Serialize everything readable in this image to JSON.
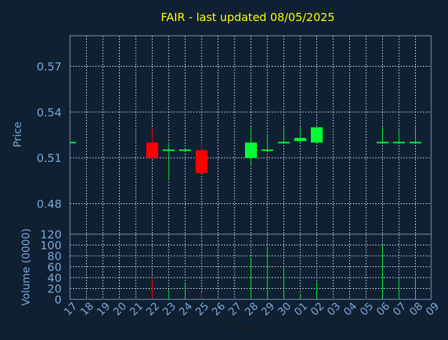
{
  "chart_data": {
    "title": "FAIR - last updated 08/05/2025",
    "type": "candlestick",
    "price_panel": {
      "ylabel": "Price",
      "ylim": [
        0.46,
        0.59
      ],
      "yticks": [
        "0.57",
        "0.54",
        "0.51",
        "0.48"
      ],
      "ytick_values": [
        0.57,
        0.54,
        0.51,
        0.48
      ],
      "candles": [
        {
          "day": "17",
          "open": 0.52,
          "high": 0.52,
          "low": 0.52,
          "close": 0.52
        },
        {
          "day": "22",
          "open": 0.52,
          "high": 0.53,
          "low": 0.51,
          "close": 0.51
        },
        {
          "day": "23",
          "open": 0.515,
          "high": 0.52,
          "low": 0.495,
          "close": 0.515
        },
        {
          "day": "24",
          "open": 0.515,
          "high": 0.515,
          "low": 0.515,
          "close": 0.515
        },
        {
          "day": "25",
          "open": 0.515,
          "high": 0.52,
          "low": 0.5,
          "close": 0.5
        },
        {
          "day": "28",
          "open": 0.51,
          "high": 0.53,
          "low": 0.505,
          "close": 0.52
        },
        {
          "day": "29",
          "open": 0.515,
          "high": 0.525,
          "low": 0.515,
          "close": 0.515
        },
        {
          "day": "30",
          "open": 0.52,
          "high": 0.53,
          "low": 0.52,
          "close": 0.52
        },
        {
          "day": "01",
          "open": 0.521,
          "high": 0.53,
          "low": 0.52,
          "close": 0.523
        },
        {
          "day": "02",
          "open": 0.52,
          "high": 0.53,
          "low": 0.52,
          "close": 0.53
        },
        {
          "day": "06",
          "open": 0.52,
          "high": 0.53,
          "low": 0.52,
          "close": 0.52
        },
        {
          "day": "07",
          "open": 0.52,
          "high": 0.528,
          "low": 0.52,
          "close": 0.52
        },
        {
          "day": "08",
          "open": 0.52,
          "high": 0.53,
          "low": 0.52,
          "close": 0.52
        }
      ]
    },
    "volume_panel": {
      "ylabel": "Volume (0000)",
      "ylim": [
        0,
        120
      ],
      "yticks": [
        "120",
        "100",
        "80",
        "60",
        "40",
        "20",
        "0"
      ],
      "ytick_values": [
        120,
        100,
        80,
        60,
        40,
        20,
        0
      ],
      "bars": [
        {
          "day": "22",
          "value": 40,
          "dir": "down"
        },
        {
          "day": "23",
          "value": 18,
          "dir": "up"
        },
        {
          "day": "24",
          "value": 30,
          "dir": "up"
        },
        {
          "day": "25",
          "value": 12,
          "dir": "down"
        },
        {
          "day": "28",
          "value": 78,
          "dir": "up"
        },
        {
          "day": "29",
          "value": 98,
          "dir": "up"
        },
        {
          "day": "30",
          "value": 58,
          "dir": "up"
        },
        {
          "day": "01",
          "value": 10,
          "dir": "up"
        },
        {
          "day": "02",
          "value": 32,
          "dir": "up"
        },
        {
          "day": "06",
          "value": 100,
          "dir": "up"
        },
        {
          "day": "07",
          "value": 38,
          "dir": "up"
        },
        {
          "day": "08",
          "value": 42,
          "dir": "up"
        }
      ]
    },
    "x_categories": [
      "17",
      "18",
      "19",
      "20",
      "21",
      "22",
      "23",
      "24",
      "25",
      "26",
      "27",
      "28",
      "29",
      "30",
      "01",
      "02",
      "03",
      "04",
      "05",
      "06",
      "07",
      "08",
      "09"
    ],
    "xlabel": "Day",
    "grid": true,
    "colors": {
      "background": "#102033",
      "frame": "#7a9cc0",
      "grid": "#c8d0dc",
      "title": "#ffff00",
      "axis_text": "#7aa8d8",
      "up": "#00ff33",
      "down": "#ff0000"
    }
  }
}
